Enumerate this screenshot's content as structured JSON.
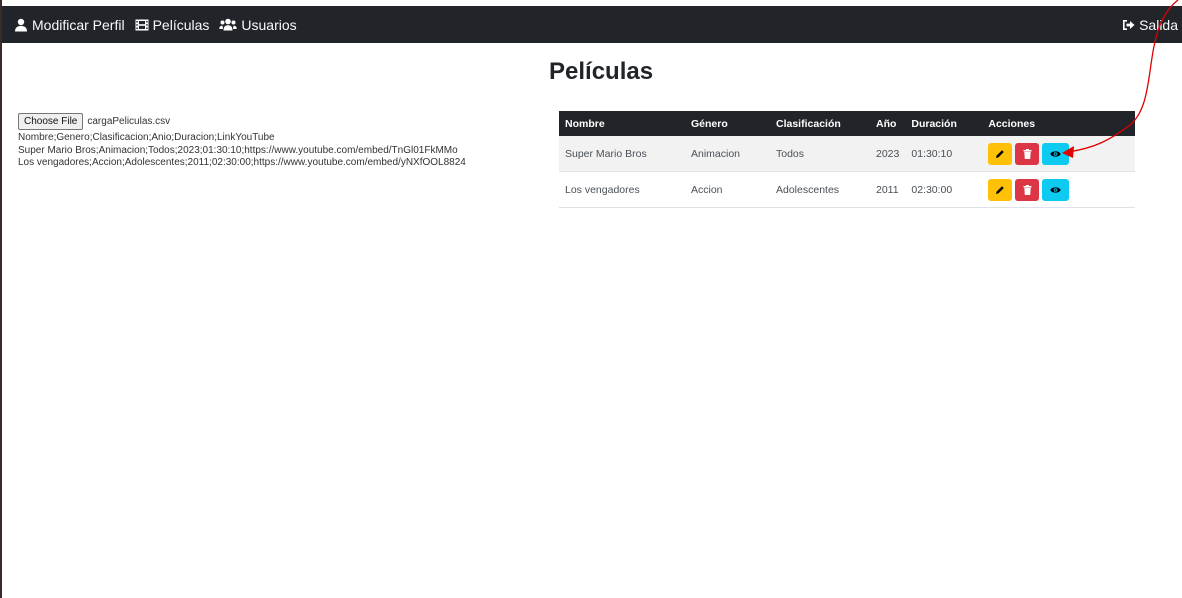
{
  "navbar": {
    "profile_label": "Modificar Perfil",
    "movies_label": "Películas",
    "users_label": "Usuarios",
    "exit_label": "Salida"
  },
  "page": {
    "title": "Películas"
  },
  "upload": {
    "button_label": "Choose File",
    "file_name": "cargaPeliculas.csv",
    "lines": [
      "Nombre;Genero;Clasificacion;Anio;Duracion;LinkYouTube",
      "Super Mario Bros;Animacion;Todos;2023;01:30:10;https://www.youtube.com/embed/TnGl01FkMMo",
      "Los vengadores;Accion;Adolescentes;2011;02:30:00;https://www.youtube.com/embed/yNXfOOL8824"
    ]
  },
  "table": {
    "headers": [
      "Nombre",
      "Género",
      "Clasificación",
      "Año",
      "Duración",
      "Acciones"
    ],
    "rows": [
      [
        "Super Mario Bros",
        "Animacion",
        "Todos",
        "2023",
        "01:30:10"
      ],
      [
        "Los vengadores",
        "Accion",
        "Adolescentes",
        "2011",
        "02:30:00"
      ]
    ]
  },
  "icons": {
    "profile": "user-icon",
    "movies": "film-icon",
    "users": "users-icon",
    "exit": "sign-out-icon",
    "edit": "pencil-icon",
    "delete": "trash-icon",
    "view": "eye-icon"
  },
  "colors": {
    "navbar": "#212529",
    "edit": "#ffc107",
    "delete": "#dc3545",
    "view": "#0dcaf0",
    "annotation_arrow": "#e00000"
  }
}
